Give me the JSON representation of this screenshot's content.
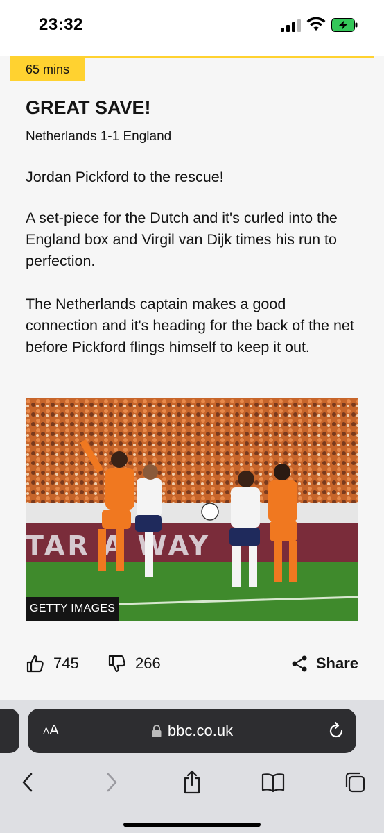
{
  "status_bar": {
    "time": "23:32",
    "battery_color": "#34c759"
  },
  "entry": {
    "time_badge": "65 mins",
    "accent_color": "#ffd230",
    "headline": "GREAT SAVE!",
    "score": "Netherlands 1-1 England",
    "paragraphs": [
      "Jordan Pickford to the rescue!",
      "A set-piece for the Dutch and it's curled into the England box and Virgil van Dijk times his run to perfection.",
      "The Netherlands captain makes a good connection and it's heading for the back of the net before Pickford flings himself to keep it out."
    ],
    "image": {
      "credit": "GETTY IMAGES",
      "ad_board_text": "TAR A WAY"
    },
    "reactions": {
      "likes": "745",
      "dislikes": "266",
      "share_label": "Share"
    }
  },
  "browser": {
    "text_size_label_small": "A",
    "text_size_label_large": "A",
    "url": "bbc.co.uk",
    "icons": [
      "back-icon",
      "forward-icon",
      "share-icon",
      "bookmarks-icon",
      "tabs-icon"
    ]
  }
}
